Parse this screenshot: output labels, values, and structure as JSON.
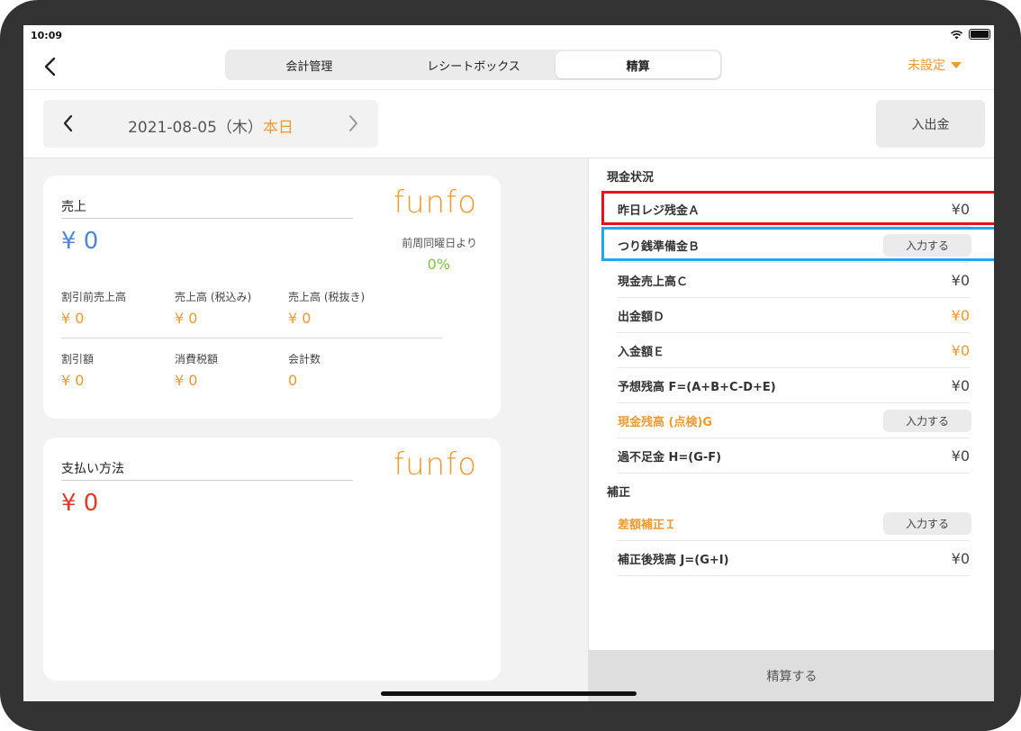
{
  "status": {
    "time": "10:09"
  },
  "nav": {
    "tabs": [
      {
        "label": "会計管理"
      },
      {
        "label": "レシートボックス"
      },
      {
        "label": "精算"
      }
    ],
    "user_dropdown": "未設定"
  },
  "date_bar": {
    "date": "2021-08-05（木）",
    "today": "本日",
    "in_out_button": "入出金"
  },
  "sales_card": {
    "title": "売上",
    "total": "¥ 0",
    "logo": "funfo",
    "compare_label": "前周同曜日より",
    "compare_value": "0%",
    "stats": [
      {
        "label": "割引前売上高",
        "value": "¥ 0"
      },
      {
        "label": "売上高 (税込み)",
        "value": "¥ 0"
      },
      {
        "label": "売上高 (税抜き)",
        "value": "¥ 0"
      },
      {
        "label": "割引額",
        "value": "¥ 0"
      },
      {
        "label": "消費税額",
        "value": "¥ 0"
      },
      {
        "label": "会計数",
        "value": "0"
      }
    ]
  },
  "payment_card": {
    "title": "支払い方法",
    "total": "¥ 0",
    "logo": "funfo"
  },
  "cash_status": {
    "title": "現金状況",
    "input_button_label": "入力する",
    "rows": [
      {
        "label": "昨日レジ残金Ａ",
        "value": "¥0"
      },
      {
        "label": "つり銭準備金Ｂ",
        "value": ""
      },
      {
        "label": "現金売上高Ｃ",
        "value": "¥0"
      },
      {
        "label": "出金額Ｄ",
        "value": "¥0"
      },
      {
        "label": "入金額Ｅ",
        "value": "¥0"
      },
      {
        "label": "予想残高 F=(A+B+C-D+E)",
        "value": "¥0"
      },
      {
        "label": "現金残高 (点検)G",
        "value": ""
      },
      {
        "label": "過不足金 H=(G-F)",
        "value": "¥0"
      }
    ]
  },
  "correction": {
    "title": "補正",
    "rows": [
      {
        "label": "差額補正Ｉ",
        "value": ""
      },
      {
        "label": "補正後残高 J=(G+I)",
        "value": "¥0"
      }
    ]
  },
  "settle_button": "精算する",
  "colors": {
    "accent": "#ee9a30",
    "sales_blue": "#4f87d6",
    "payment_red": "#e53928",
    "percent_green": "#7fc642",
    "highlight_red": "#e8121d",
    "highlight_blue": "#1ea9e8"
  }
}
